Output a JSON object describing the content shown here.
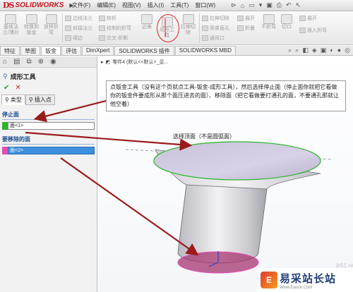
{
  "app": {
    "logo_ds": "DS",
    "logo_name": "SOLIDWORKS"
  },
  "menu": [
    "文件(F)",
    "编辑(E)",
    "视图(V)",
    "插入(I)",
    "工具(T)",
    "窗口(W)"
  ],
  "ribbon": {
    "big_left": [
      {
        "label1": "基体法",
        "label2": "兰/薄片"
      },
      {
        "label1": "转换到",
        "label2": "钣金"
      },
      {
        "label1": "放样折",
        "label2": "弯"
      }
    ],
    "small_mid": [
      "边线法兰",
      "斜接法兰",
      "褶边",
      "转折",
      "绘制的折弯",
      "交叉-折断"
    ],
    "big_mid": [
      {
        "label1": "边角",
        "label2": ""
      },
      {
        "label1": "成形工",
        "label2": "具"
      },
      {
        "label1": "拉伸切",
        "label2": "除"
      }
    ],
    "small_right": [
      "拉伸切除",
      "简单直孔",
      "通风口",
      "展开",
      "折叠"
    ],
    "big_right": [
      {
        "label1": "不折弯",
        "label2": ""
      },
      {
        "label1": "切口",
        "label2": ""
      }
    ],
    "small_far": [
      "展开",
      "插入折弯"
    ]
  },
  "tabs": [
    "特征",
    "草图",
    "钣金",
    "评估",
    "DimXpert",
    "SOLIDWORKS 插件",
    "SOLIDWORKS MBD"
  ],
  "active_tab": "钣金",
  "tree_path": "零件4 (默认<<默认>_显...",
  "panel": {
    "title": "成形工具",
    "ok": "✔",
    "cancel": "✕",
    "subtab_type": "类型",
    "subtab_insert": "插入点",
    "stop_face_head": "停止面",
    "stop_face_value": "面<1>",
    "remove_face_head": "要移除的面",
    "remove_face_value": "面<2>"
  },
  "note": "点钣金工具（没有这个页就点工具-钣金-成形工具），然后选择停止面（停止面你就把它看做你的钣金件要成形从那个面压进去的面）、移除面（把它看做要打通孔的面，不要通孔那就让他空着）",
  "label_top": "选择顶面（不是圆弧面）",
  "watermark": {
    "site": "jb51.net",
    "brand": "易采站长站",
    "url": "Www.Easck.Com",
    "badge": "E"
  },
  "colors": {
    "stop_swatch": "#2ab52a",
    "remove_swatch": "#e34fb0",
    "arrow": "#9b1b1b",
    "highlight": "#3c8fdc"
  }
}
